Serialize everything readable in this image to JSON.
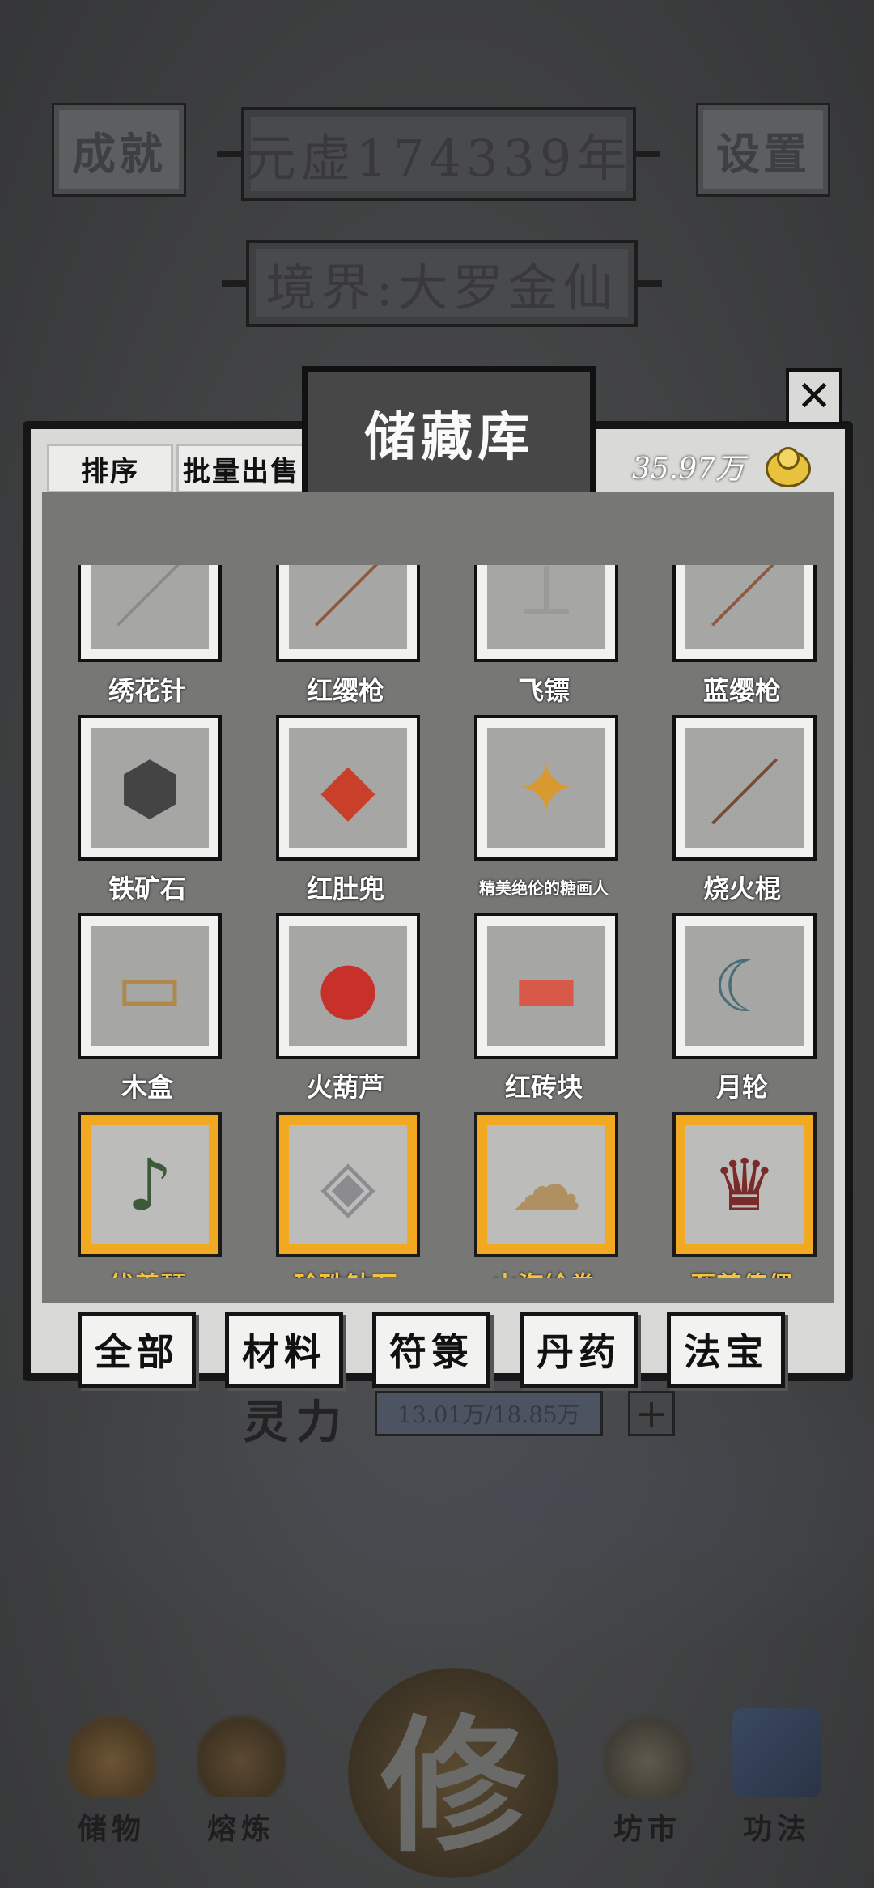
{
  "background": {
    "achievement_label": "成就",
    "year_label": "元虚174339年",
    "settings_label": "设置",
    "realm_label": "境界:大罗金仙",
    "lingli_label": "灵力",
    "lingli_value": "13.01万/18.85万",
    "plus_label": "+",
    "xiu_label": "修",
    "nav": [
      {
        "label": "储物",
        "icon": "pouch-icon"
      },
      {
        "label": "熔炼",
        "icon": "furnace-icon"
      },
      {
        "label": "坊市",
        "icon": "coins-stack-icon"
      },
      {
        "label": "功法",
        "icon": "book-icon"
      }
    ]
  },
  "modal": {
    "title": "储藏库",
    "sort_label": "排序",
    "batch_sell_label": "批量出售",
    "currency_amount": "35.97万",
    "close_label": "✕",
    "items": [
      {
        "name": "绣花针",
        "icon": "needle-icon",
        "glyph": "／",
        "rare": false
      },
      {
        "name": "红缨枪",
        "icon": "spear-icon",
        "glyph": "／",
        "rare": false
      },
      {
        "name": "飞镖",
        "icon": "dart-icon",
        "glyph": "⟂",
        "rare": false
      },
      {
        "name": "蓝缨枪",
        "icon": "spear-icon",
        "glyph": "／",
        "rare": false
      },
      {
        "name": "铁矿石",
        "icon": "iron-ore-icon",
        "glyph": "⬢",
        "rare": false
      },
      {
        "name": "红肚兜",
        "icon": "red-apron-icon",
        "glyph": "◆",
        "rare": false
      },
      {
        "name": "精美绝伦的糖画人",
        "icon": "sugar-figure-icon",
        "glyph": "✦",
        "rare": false,
        "small": true
      },
      {
        "name": "烧火棍",
        "icon": "fire-stick-icon",
        "glyph": "／",
        "rare": false
      },
      {
        "name": "木盒",
        "icon": "wooden-box-icon",
        "glyph": "▭",
        "rare": false
      },
      {
        "name": "火葫芦",
        "icon": "gourd-icon",
        "glyph": "●",
        "rare": false
      },
      {
        "name": "红砖块",
        "icon": "brick-icon",
        "glyph": "▬",
        "rare": false
      },
      {
        "name": "月轮",
        "icon": "moon-blade-icon",
        "glyph": "☾",
        "rare": false
      },
      {
        "name": "伏羲琴",
        "icon": "fuxi-lute-icon",
        "glyph": "♪",
        "rare": true
      },
      {
        "name": "珍珠钻石",
        "icon": "diamond-block-icon",
        "glyph": "◈",
        "rare": true
      },
      {
        "name": "山海绘卷",
        "icon": "scroll-icon",
        "glyph": "☁",
        "rare": true
      },
      {
        "name": "至尊傀儡",
        "icon": "puppet-icon",
        "glyph": "♛",
        "rare": true
      }
    ],
    "categories": [
      "全部",
      "材料",
      "符箓",
      "丹药",
      "法宝"
    ]
  }
}
